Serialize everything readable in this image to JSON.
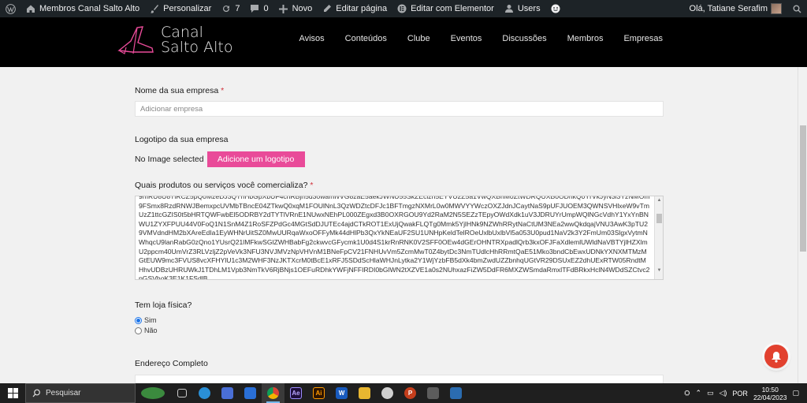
{
  "adminbar": {
    "site_name": "Membros Canal Salto Alto",
    "customize": "Personalizar",
    "updates": "7",
    "comments": "0",
    "new": "Novo",
    "edit_page": "Editar página",
    "edit_elementor": "Editar com Elementor",
    "users": "Users",
    "greeting": "Olá, Tatiane Serafim"
  },
  "header": {
    "logo_line1": "Canal",
    "logo_line2": "Salto Alto",
    "nav": [
      "Avisos",
      "Conteúdos",
      "Clube",
      "Eventos",
      "Discussões",
      "Membros",
      "Empresas"
    ]
  },
  "form": {
    "company_label": "Nome da sua empresa",
    "company_placeholder": "Adicionar empresa",
    "logo_label": "Logotipo da sua empresa",
    "no_image": "No Image selected",
    "add_logo_button": "Adicione um logotipo",
    "products_label": "Quais produtos ou serviços você comercializa?",
    "products_value": "9mRU8U8TlRCZ5pQ0MzeDJ3QThHbGpXbUF4cnRBjh5d3owamIvVG8zaE5aekJWNU55SkZEcizh5EYVU2Z5a1VwQXBhM0ZtWDRQUXB0ODhkQ0YrVkJyN3l3YzNMOm9FSmx8RzdRNWJBemxpcUVMbTBncE04ZTkwQ0xqM1FOUlNnL3QzWDZtcDFJc1BFTmgzNXMrL0w0MWVYYWczOXZJdnJCaytNaS9pUFJUOEM3QWNSVHlxeW9vTmUzZ1ttcGZIS0t5bHRTQWFwbEl5ODRBY2dTYTlVRnE1NUwxNEhPL000ZEgxd3B0OXRGOU9Yd2RaM2N5SEZzTEpyOWdXdk1uV3JDRUYrUmpWQlNGcVdhY1YxYnBNWU1ZYXFPUU44V0FoQ1N1SnM4Z1RoSFZPdGc4MGtSdDJUTEc4ajdCTkROT1ExUjQwakFLQTg0Mmk5YjlHNk9NZWhRRytNaCtUM3NEa2wwQkdqajVNU3AwK3pTU29VMVdndHM2bXAreEdIa1EyWHNrUitSZ0MwUURqaWxoOFFyMk44dHlPb3QxYkNEaUF2SU1UNHpKeldTelROeUxlbUxlbVl5a053U0pud1NaV2k3Y2FmUm03SlgxVytmNWhqcU9lanRabG0zQno1YUsrQ21lMFkwSGlZWHBabFg2ckwvcGFycmk1U0d4S1krRnRNK0V2SFF0OEw4dGErOHNTRXpadlQrb3kxOFJFaXdlemlUWldNaVBTYjlHZXlmU2ppcm40UmVrZ3RLVzljZ2pVeVk3NFU3NVJMVzNpVHVnM1BNeFpCV21FNHUvVm5ZcmMwT0Z4bytDc3NmTUdlcHhRRmtQaE51Mko3bndCbEwxUDNkYXNXMTMzMGtEUW9mc3FVUS8vcXFHYlU1c3M2WHF3NzJKTXcrM0tBcE1xRFJ5SDdScHlaWHJnLytka2Y1WjYzbFB5dXk4bmZwdUZZbnhqUGtVR29DSUxEZ2dhUExRTW05RndtMHhvUDBzUHRUWkJ1TDhLM1Vpb3NmTkV6RjBNjs1OEFuRDhkYWFjNFFIRDI0bGlWN2tXZVE1a0s2NUhxazFiZW5DdFR6MXZWSmdaRmxlTFdBRkxHclN4WDdSZCtvc2pGSVhoK3E1K1FSdlB",
    "store_label": "Tem loja física?",
    "store_options": [
      {
        "label": "Sim",
        "checked": true
      },
      {
        "label": "Não",
        "checked": false
      }
    ],
    "address_label": "Endereço Completo"
  },
  "taskbar": {
    "search_placeholder": "Pesquisar",
    "lang": "POR",
    "time": "10:50",
    "date": "22/04/2023"
  },
  "colors": {
    "accent_pink": "#e94b99",
    "header_bg": "#000000",
    "adminbar_bg": "#1d2327",
    "required": "#d0303a"
  }
}
